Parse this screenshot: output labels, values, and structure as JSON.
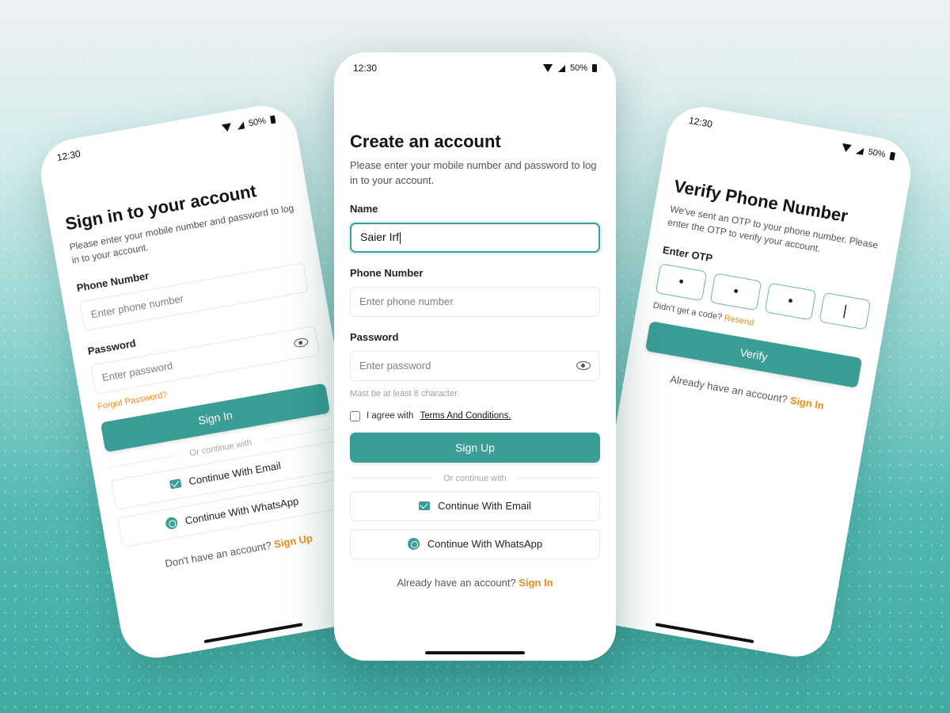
{
  "status_bar": {
    "time": "12:30",
    "battery": "50%"
  },
  "sign_in": {
    "title": "Sign in to your account",
    "subtitle": "Please enter your mobile number and password to log in to your account.",
    "phone_label": "Phone Number",
    "phone_placeholder": "Enter phone number",
    "password_label": "Password",
    "password_placeholder": "Enter password",
    "forgot": "Forgot Password?",
    "button": "Sign In",
    "divider": "Or continue with",
    "email_button": "Continue With Email",
    "whatsapp_button": "Continue With WhatsApp",
    "footer_text": "Don't have an account?",
    "footer_link": "Sign Up"
  },
  "create_account": {
    "title": "Create an account",
    "subtitle": "Please enter your mobile number and password to log in to your account.",
    "name_label": "Name",
    "name_value": "Saier Irf",
    "phone_label": "Phone Number",
    "phone_placeholder": "Enter phone number",
    "password_label": "Password",
    "password_placeholder": "Enter password",
    "password_hint": "Mast be at least 8 character.",
    "agree_text": "I agree with",
    "terms_link": "Terms And Conditions.",
    "button": "Sign Up",
    "divider": "Or continue with",
    "email_button": "Continue With Email",
    "whatsapp_button": "Continue With WhatsApp",
    "footer_text": "Already have an account?",
    "footer_link": "Sign In"
  },
  "verify": {
    "title": "Verify Phone Number",
    "subtitle": "We've sent an OTP to your phone number. Please enter the OTP to verify your account.",
    "otp_label": "Enter OTP",
    "otp_digits": [
      "•",
      "•",
      "•",
      "|"
    ],
    "no_code": "Didn't get a code?",
    "resend": "Resend",
    "button": "Verify",
    "footer_text": "Already have an account?",
    "footer_link": "Sign In"
  },
  "colors": {
    "accent": "#3a9e96",
    "link": "#f08b1b"
  }
}
